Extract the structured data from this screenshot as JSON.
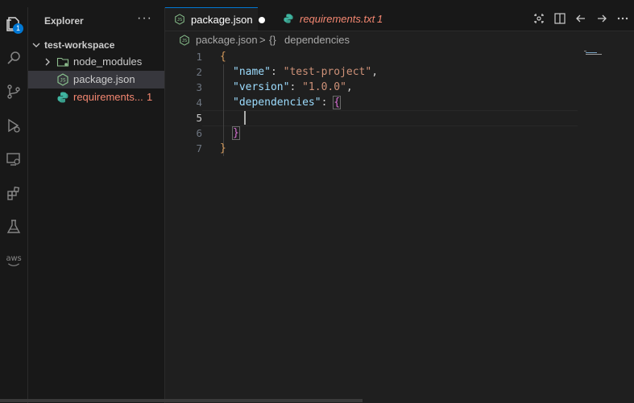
{
  "activity_bar": {
    "items": [
      {
        "name": "explorer-icon",
        "active": true,
        "badge": "1"
      },
      {
        "name": "search-icon"
      },
      {
        "name": "source-control-icon"
      },
      {
        "name": "run-debug-icon"
      },
      {
        "name": "remote-explorer-icon"
      },
      {
        "name": "extensions-icon"
      },
      {
        "name": "testing-icon"
      },
      {
        "name": "aws-icon",
        "label": "aws"
      }
    ]
  },
  "sidebar": {
    "title": "Explorer",
    "more": "···",
    "workspace": "test-workspace",
    "items": [
      {
        "label": "node_modules",
        "type": "folder"
      },
      {
        "label": "package.json",
        "type": "json",
        "selected": true
      },
      {
        "label": "requirements...",
        "type": "python",
        "errors": "1"
      }
    ]
  },
  "tabs": [
    {
      "label": "package.json",
      "active": true,
      "dirty": true
    },
    {
      "label": "requirements.txt",
      "errors": "1",
      "italic": true
    }
  ],
  "breadcrumb": {
    "file": "package.json",
    "separator": ">",
    "symbol_icon": "{}",
    "symbol": "dependencies"
  },
  "editor": {
    "line_numbers": [
      "1",
      "2",
      "3",
      "4",
      "5",
      "6",
      "7"
    ],
    "current_line": 5,
    "lines": {
      "l1_open": "{",
      "l2_key": "\"name\"",
      "l2_sep": ": ",
      "l2_val": "\"test-project\"",
      "l2_end": ",",
      "l3_key": "\"version\"",
      "l3_sep": ": ",
      "l3_val": "\"1.0.0\"",
      "l3_end": ",",
      "l4_key": "\"dependencies\"",
      "l4_sep": ": ",
      "l4_brace": "{",
      "l6_brace": "}",
      "l7_close": "}"
    }
  },
  "colors": {
    "accent": "#0078d4",
    "error": "#f48771",
    "json_key": "#9cdcfe",
    "json_string": "#ce9178",
    "brace": "#d49a5c"
  }
}
